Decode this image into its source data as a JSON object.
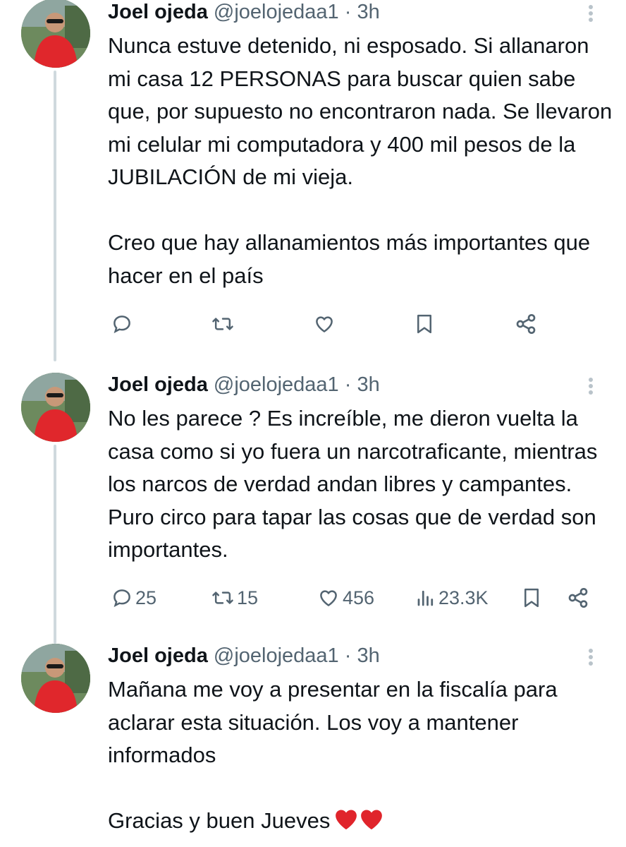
{
  "tweets": [
    {
      "name": "Joel ojeda",
      "handle": "@joelojedaa1",
      "separator": "·",
      "time": "3h",
      "text": "Nunca estuve detenido, ni esposado. Si allanaron mi casa 12 PERSONAS para buscar quien sabe que, por supuesto no encontraron nada. Se llevaron mi celular mi computadora y 400 mil pesos de la JUBILACIÓN de mi vieja.\n\nCreo que hay allanamientos más importantes que hacer en el país",
      "actions": {
        "replies": "",
        "reposts": "",
        "likes": "",
        "views": ""
      },
      "icons": [
        "reply-icon",
        "repost-icon",
        "like-icon",
        "bookmark-icon",
        "share-icon"
      ]
    },
    {
      "name": "Joel ojeda",
      "handle": "@joelojedaa1",
      "separator": "·",
      "time": "3h",
      "text": "No les parece ? Es increíble, me dieron vuelta la casa como si yo fuera un narcotraficante, mientras los narcos de verdad andan libres y campantes. Puro circo para tapar las cosas que de verdad son importantes.",
      "actions": {
        "replies": "25",
        "reposts": "15",
        "likes": "456",
        "views": "23.3K"
      },
      "icons": [
        "reply-icon",
        "repost-icon",
        "like-icon",
        "views-icon",
        "bookmark-icon",
        "share-icon"
      ]
    },
    {
      "name": "Joel ojeda",
      "handle": "@joelojedaa1",
      "separator": "·",
      "time": "3h",
      "text": "Mañana me voy a presentar en la fiscalía para aclarar esta situación. Los voy a mantener informados\n\nGracias y buen Jueves",
      "emoji": "heart-emoji x2"
    }
  ],
  "colors": {
    "text": "#0f1419",
    "secondary": "#536471",
    "thread_line": "#cfd9de",
    "heart": "#e0242b"
  }
}
